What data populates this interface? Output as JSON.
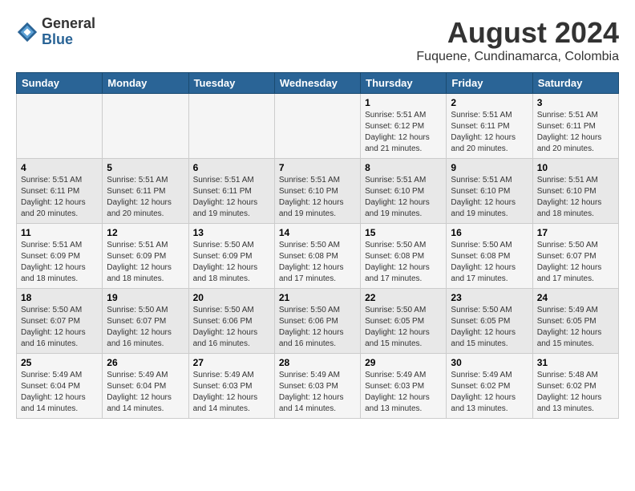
{
  "logo": {
    "general": "General",
    "blue": "Blue"
  },
  "header": {
    "month": "August 2024",
    "location": "Fuquene, Cundinamarca, Colombia"
  },
  "weekdays": [
    "Sunday",
    "Monday",
    "Tuesday",
    "Wednesday",
    "Thursday",
    "Friday",
    "Saturday"
  ],
  "weeks": [
    [
      {
        "day": "",
        "info": ""
      },
      {
        "day": "",
        "info": ""
      },
      {
        "day": "",
        "info": ""
      },
      {
        "day": "",
        "info": ""
      },
      {
        "day": "1",
        "info": "Sunrise: 5:51 AM\nSunset: 6:12 PM\nDaylight: 12 hours\nand 21 minutes."
      },
      {
        "day": "2",
        "info": "Sunrise: 5:51 AM\nSunset: 6:11 PM\nDaylight: 12 hours\nand 20 minutes."
      },
      {
        "day": "3",
        "info": "Sunrise: 5:51 AM\nSunset: 6:11 PM\nDaylight: 12 hours\nand 20 minutes."
      }
    ],
    [
      {
        "day": "4",
        "info": "Sunrise: 5:51 AM\nSunset: 6:11 PM\nDaylight: 12 hours\nand 20 minutes."
      },
      {
        "day": "5",
        "info": "Sunrise: 5:51 AM\nSunset: 6:11 PM\nDaylight: 12 hours\nand 20 minutes."
      },
      {
        "day": "6",
        "info": "Sunrise: 5:51 AM\nSunset: 6:11 PM\nDaylight: 12 hours\nand 19 minutes."
      },
      {
        "day": "7",
        "info": "Sunrise: 5:51 AM\nSunset: 6:10 PM\nDaylight: 12 hours\nand 19 minutes."
      },
      {
        "day": "8",
        "info": "Sunrise: 5:51 AM\nSunset: 6:10 PM\nDaylight: 12 hours\nand 19 minutes."
      },
      {
        "day": "9",
        "info": "Sunrise: 5:51 AM\nSunset: 6:10 PM\nDaylight: 12 hours\nand 19 minutes."
      },
      {
        "day": "10",
        "info": "Sunrise: 5:51 AM\nSunset: 6:10 PM\nDaylight: 12 hours\nand 18 minutes."
      }
    ],
    [
      {
        "day": "11",
        "info": "Sunrise: 5:51 AM\nSunset: 6:09 PM\nDaylight: 12 hours\nand 18 minutes."
      },
      {
        "day": "12",
        "info": "Sunrise: 5:51 AM\nSunset: 6:09 PM\nDaylight: 12 hours\nand 18 minutes."
      },
      {
        "day": "13",
        "info": "Sunrise: 5:50 AM\nSunset: 6:09 PM\nDaylight: 12 hours\nand 18 minutes."
      },
      {
        "day": "14",
        "info": "Sunrise: 5:50 AM\nSunset: 6:08 PM\nDaylight: 12 hours\nand 17 minutes."
      },
      {
        "day": "15",
        "info": "Sunrise: 5:50 AM\nSunset: 6:08 PM\nDaylight: 12 hours\nand 17 minutes."
      },
      {
        "day": "16",
        "info": "Sunrise: 5:50 AM\nSunset: 6:08 PM\nDaylight: 12 hours\nand 17 minutes."
      },
      {
        "day": "17",
        "info": "Sunrise: 5:50 AM\nSunset: 6:07 PM\nDaylight: 12 hours\nand 17 minutes."
      }
    ],
    [
      {
        "day": "18",
        "info": "Sunrise: 5:50 AM\nSunset: 6:07 PM\nDaylight: 12 hours\nand 16 minutes."
      },
      {
        "day": "19",
        "info": "Sunrise: 5:50 AM\nSunset: 6:07 PM\nDaylight: 12 hours\nand 16 minutes."
      },
      {
        "day": "20",
        "info": "Sunrise: 5:50 AM\nSunset: 6:06 PM\nDaylight: 12 hours\nand 16 minutes."
      },
      {
        "day": "21",
        "info": "Sunrise: 5:50 AM\nSunset: 6:06 PM\nDaylight: 12 hours\nand 16 minutes."
      },
      {
        "day": "22",
        "info": "Sunrise: 5:50 AM\nSunset: 6:05 PM\nDaylight: 12 hours\nand 15 minutes."
      },
      {
        "day": "23",
        "info": "Sunrise: 5:50 AM\nSunset: 6:05 PM\nDaylight: 12 hours\nand 15 minutes."
      },
      {
        "day": "24",
        "info": "Sunrise: 5:49 AM\nSunset: 6:05 PM\nDaylight: 12 hours\nand 15 minutes."
      }
    ],
    [
      {
        "day": "25",
        "info": "Sunrise: 5:49 AM\nSunset: 6:04 PM\nDaylight: 12 hours\nand 14 minutes."
      },
      {
        "day": "26",
        "info": "Sunrise: 5:49 AM\nSunset: 6:04 PM\nDaylight: 12 hours\nand 14 minutes."
      },
      {
        "day": "27",
        "info": "Sunrise: 5:49 AM\nSunset: 6:03 PM\nDaylight: 12 hours\nand 14 minutes."
      },
      {
        "day": "28",
        "info": "Sunrise: 5:49 AM\nSunset: 6:03 PM\nDaylight: 12 hours\nand 14 minutes."
      },
      {
        "day": "29",
        "info": "Sunrise: 5:49 AM\nSunset: 6:03 PM\nDaylight: 12 hours\nand 13 minutes."
      },
      {
        "day": "30",
        "info": "Sunrise: 5:49 AM\nSunset: 6:02 PM\nDaylight: 12 hours\nand 13 minutes."
      },
      {
        "day": "31",
        "info": "Sunrise: 5:48 AM\nSunset: 6:02 PM\nDaylight: 12 hours\nand 13 minutes."
      }
    ]
  ]
}
